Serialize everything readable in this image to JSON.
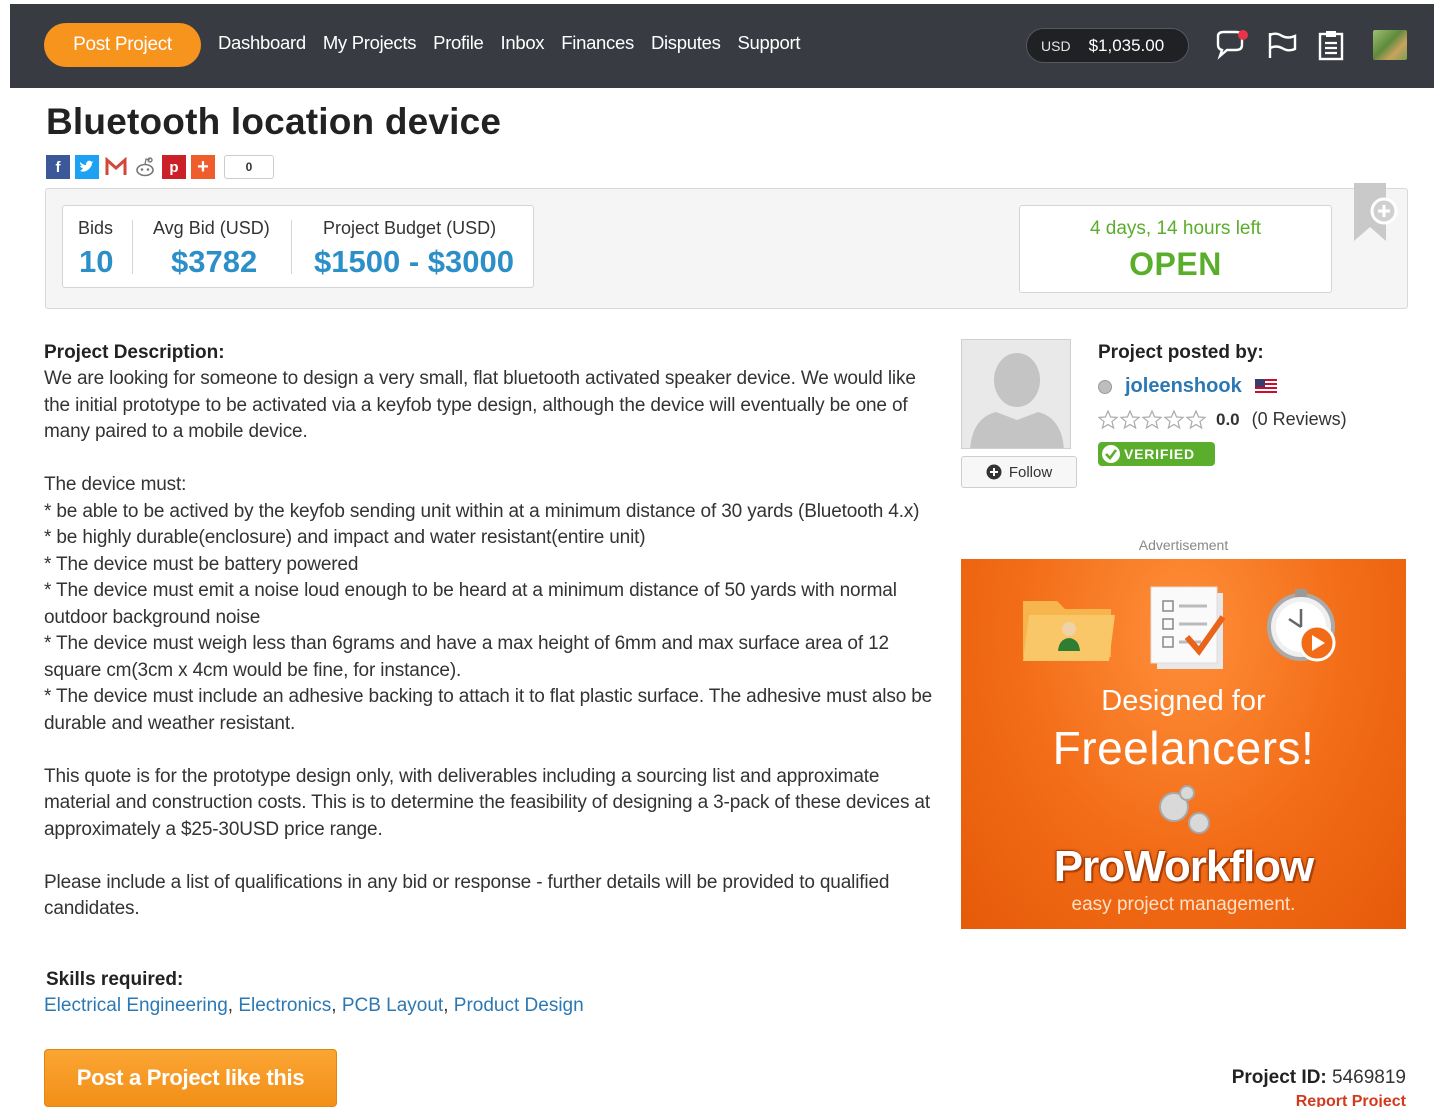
{
  "navbar": {
    "post_project": "Post Project",
    "links": [
      "Dashboard",
      "My Projects",
      "Profile",
      "Inbox",
      "Finances",
      "Disputes",
      "Support"
    ],
    "balance": {
      "currency": "USD",
      "amount": "$1,035.00"
    },
    "icons": [
      "chat-notification-icon",
      "flag-icon",
      "clipboard-icon",
      "user-avatar"
    ]
  },
  "project": {
    "title": "Bluetooth location device",
    "share_count": "0",
    "stats": {
      "bids_label": "Bids",
      "bids_value": "10",
      "avg_label": "Avg Bid (USD)",
      "avg_value": "$3782",
      "budget_label": "Project Budget (USD)",
      "budget_value": "$1500 - $3000"
    },
    "time_left": "4 days, 14 hours left",
    "status": "OPEN",
    "description_heading": "Project Description:",
    "description": [
      "We are looking for someone to design a very small, flat bluetooth activated speaker device. We would like the initial prototype to be activated via a keyfob type design, although the device will eventually be one of many paired to a mobile device.",
      "",
      "The device must:",
      "* be able to be actived by the keyfob sending unit within at a minimum distance of 30 yards (Bluetooth 4.x)",
      "* be highly durable(enclosure) and impact and water resistant(entire unit)",
      "* The device must be battery powered",
      "* The device must emit a noise loud enough to be heard at a minimum distance of 50 yards with normal outdoor background noise",
      "* The device must weigh less than 6grams and have a max height of 6mm and max surface area of 12 square cm(3cm x 4cm would be fine, for instance).",
      "* The device must include an adhesive backing to attach it to flat plastic surface. The adhesive must also be durable and weather resistant.",
      "",
      "This quote is for the prototype design only, with deliverables including a sourcing list and approximate material and construction costs. This is to determine the feasibility of designing a 3-pack of these devices at approximately a $25-30USD price range.",
      "",
      "Please include a list of qualifications in any bid or response - further details will be provided to qualified candidates."
    ],
    "skills_heading": "Skills required:",
    "skills": [
      "Electrical Engineering",
      "Electronics",
      "PCB Layout",
      "Product Design"
    ],
    "post_like_button": "Post a Project like this",
    "id_label": "Project ID:",
    "id_value": "5469819",
    "report_link": "Report Project"
  },
  "poster": {
    "heading": "Project posted by:",
    "username": "joleenshook",
    "rating": "0.0",
    "reviews": "(0 Reviews)",
    "verified": "VERIFIED",
    "follow": "Follow"
  },
  "ad": {
    "label": "Advertisement",
    "line1": "Designed for",
    "line2": "Freelancers!",
    "brand": "ProWorkflow",
    "tagline": "easy project management."
  },
  "colors": {
    "navbar": "#383b42",
    "accent_orange": "#f7941d",
    "stat_blue": "#2d8fc8",
    "open_green": "#5aae2b",
    "link_blue": "#2b78b3"
  }
}
